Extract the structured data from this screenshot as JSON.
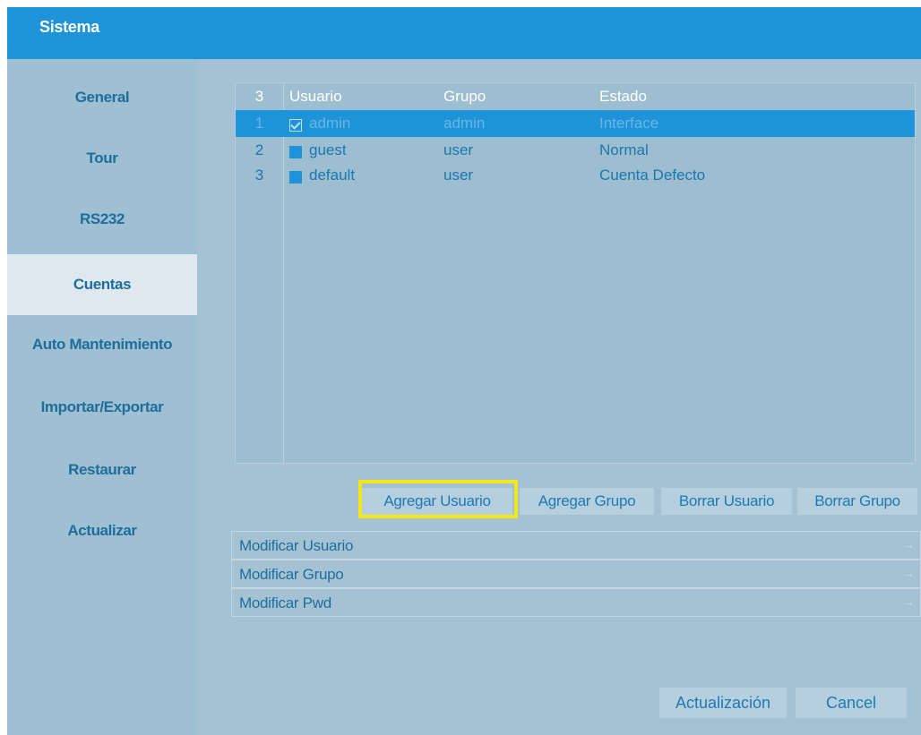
{
  "window": {
    "title": "Sistema"
  },
  "sidebar": {
    "items": [
      {
        "label": "General"
      },
      {
        "label": "Tour"
      },
      {
        "label": "RS232"
      },
      {
        "label": "Cuentas"
      },
      {
        "label": "Auto Mantenimiento"
      },
      {
        "label": "Importar/Exportar"
      },
      {
        "label": "Restaurar"
      },
      {
        "label": "Actualizar"
      }
    ],
    "active": "Cuentas"
  },
  "accounts_table": {
    "count": "3",
    "headers": {
      "user": "Usuario",
      "group": "Grupo",
      "status": "Estado"
    },
    "rows": [
      {
        "index": "1",
        "user": "admin",
        "group": "admin",
        "status": "Interface",
        "checked": true,
        "selected": true
      },
      {
        "index": "2",
        "user": "guest",
        "group": "user",
        "status": "Normal",
        "checked": false,
        "selected": false
      },
      {
        "index": "3",
        "user": "default",
        "group": "user",
        "status": "Cuenta Defecto",
        "checked": false,
        "selected": false
      }
    ]
  },
  "actions": {
    "add_user": "Agregar Usuario",
    "add_group": "Agregar Grupo",
    "delete_user": "Borrar Usuario",
    "delete_group": "Borrar Grupo"
  },
  "modify": {
    "user": "Modificar Usuario",
    "group": "Modificar Grupo",
    "pwd": "Modificar Pwd",
    "arrow_icon": "arrow-right-icon"
  },
  "footer": {
    "update": "Actualización",
    "cancel": "Cancel"
  },
  "colors": {
    "accent": "#1f93d8",
    "highlight": "#f5e61a",
    "panel": "#a5c2d5"
  }
}
